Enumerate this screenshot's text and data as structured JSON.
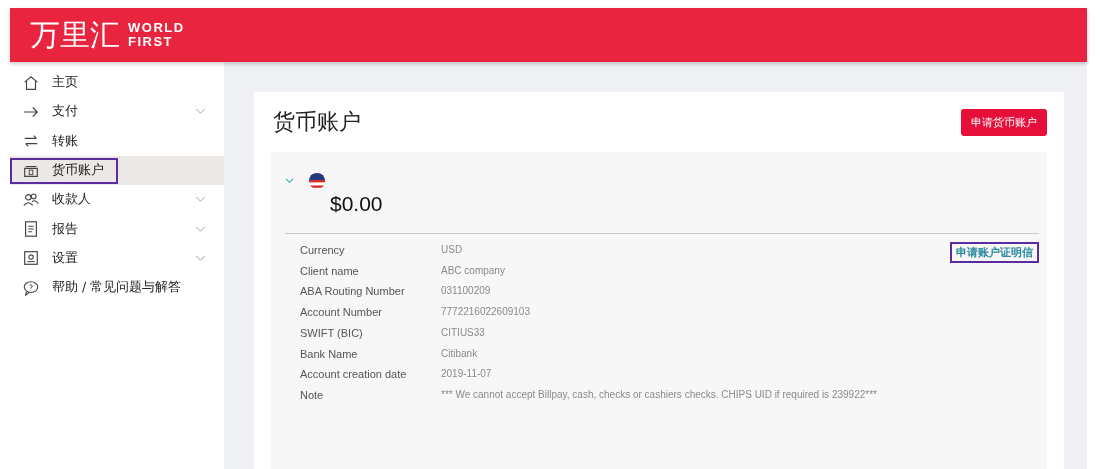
{
  "header": {
    "logo_cn": "万里汇",
    "logo_en_1": "WORLD",
    "logo_en_2": "FIRST"
  },
  "sidebar": {
    "items": [
      {
        "label": "主页",
        "expandable": false,
        "selected": false,
        "outlined": false
      },
      {
        "label": "支付",
        "expandable": true,
        "selected": false,
        "outlined": false
      },
      {
        "label": "转账",
        "expandable": false,
        "selected": false,
        "outlined": false
      },
      {
        "label": "货币账户",
        "expandable": false,
        "selected": true,
        "outlined": true
      },
      {
        "label": "收款人",
        "expandable": true,
        "selected": false,
        "outlined": false
      },
      {
        "label": "报告",
        "expandable": true,
        "selected": false,
        "outlined": false
      },
      {
        "label": "设置",
        "expandable": true,
        "selected": false,
        "outlined": false
      },
      {
        "label": "帮助 / 常见问题与解答",
        "expandable": false,
        "selected": false,
        "outlined": false
      }
    ]
  },
  "page": {
    "title": "货币账户",
    "apply_button": "申请货币账户",
    "account": {
      "expanded": true,
      "balance": "$0.00",
      "certificate_link": {
        "label": "申请账户证明信",
        "outlined": true
      },
      "details": [
        {
          "label": "Currency",
          "value": "USD"
        },
        {
          "label": "Client name",
          "value": "ABC company"
        },
        {
          "label": "ABA Routing Number",
          "value": "031100209"
        },
        {
          "label": "Account Number",
          "value": "7772216022609103"
        },
        {
          "label": "SWIFT (BIC)",
          "value": "CITIUS33"
        },
        {
          "label": "Bank Name",
          "value": "Citibank"
        },
        {
          "label": "Account creation date",
          "value": "2019-11-07"
        },
        {
          "label": "Note",
          "value": "*** We cannot accept Billpay, cash, checks or cashiers checks. CHIPS UID if required is 239922***"
        }
      ]
    }
  }
}
